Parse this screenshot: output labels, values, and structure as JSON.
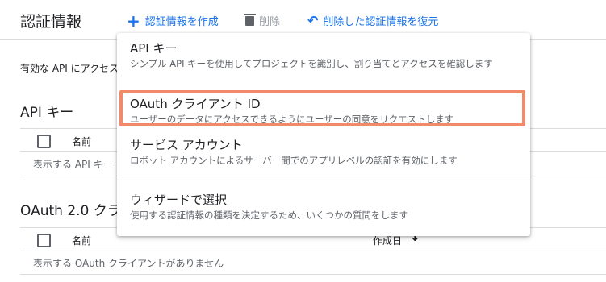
{
  "toolbar": {
    "title": "認証情報",
    "create_label": "認証情報を作成",
    "delete_label": "削除",
    "restore_label": "削除した認証情報を復元"
  },
  "intro_text": "有効な API にアクセス",
  "api_keys_section": {
    "title": "API キー",
    "col_name": "名前",
    "empty_text": "表示する API キー"
  },
  "oauth_section": {
    "title": "OAuth 2.0 クラ",
    "col_name": "名前",
    "col_date": "作成日",
    "empty_text": "表示する OAuth クライアントがありません"
  },
  "menu": {
    "items": [
      {
        "title": "API キー",
        "desc": "シンプル API キーを使用してプロジェクトを識別し、割り当てとアクセスを確認します"
      },
      {
        "title": "OAuth クライアント ID",
        "desc": "ユーザーのデータにアクセスできるようにユーザーの同意をリクエストします"
      },
      {
        "title": "サービス アカウント",
        "desc": "ロボット アカウントによるサーバー間でのアプリレベルの認証を有効にします"
      },
      {
        "title": "ウィザードで選択",
        "desc": "使用する認証情報の種類を決定するため、いくつかの質問をします"
      }
    ]
  },
  "colors": {
    "accent": "#1a73e8",
    "highlight": "#f08a6a"
  }
}
